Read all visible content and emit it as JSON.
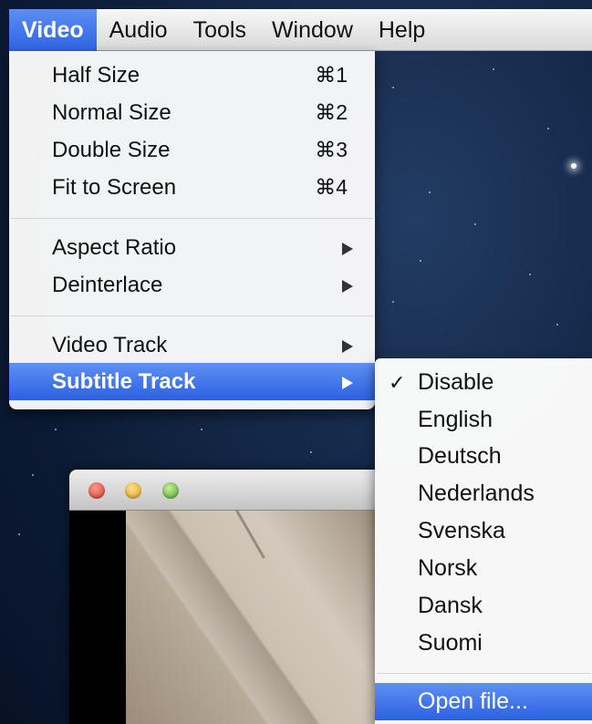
{
  "menubar": {
    "items": [
      "Video",
      "Audio",
      "Tools",
      "Window",
      "Help"
    ],
    "active": "Video"
  },
  "video_menu": {
    "items": [
      {
        "label": "Half Size",
        "shortcut": "⌘1"
      },
      {
        "label": "Normal Size",
        "shortcut": "⌘2"
      },
      {
        "label": "Double Size",
        "shortcut": "⌘3"
      },
      {
        "label": "Fit to Screen",
        "shortcut": "⌘4"
      },
      {
        "label": "Aspect Ratio"
      },
      {
        "label": "Deinterlace"
      },
      {
        "label": "Video Track"
      },
      {
        "label": "Subtitle Track"
      }
    ]
  },
  "subtitle_menu": {
    "checked": "Disable",
    "check_glyph": "✓",
    "items": [
      "Disable",
      "English",
      "Deutsch",
      "Nederlands",
      "Svenska",
      "Norsk",
      "Dansk",
      "Suomi",
      "Open file..."
    ]
  },
  "colors": {
    "selection": "#2d60e2",
    "menu_bg": "#fafafa"
  }
}
